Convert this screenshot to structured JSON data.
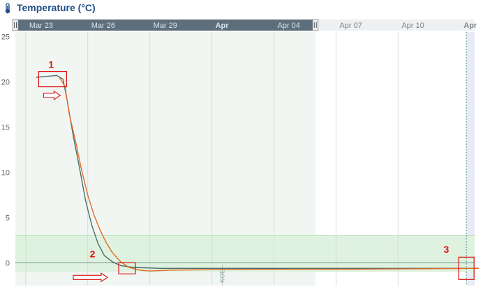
{
  "header": {
    "title": "Temperature (°C)",
    "icon": "thermometer-icon"
  },
  "chart_data": {
    "type": "line",
    "title": "Temperature (°C)",
    "ylim": [
      -2.5,
      25.5
    ],
    "y_ticks": [
      "25",
      "20",
      "15",
      "10",
      "5",
      "0"
    ],
    "y_tick_values": [
      25,
      20,
      15,
      10,
      5,
      0
    ],
    "x_ticks": [
      "Mar 23",
      "Mar 26",
      "Mar 29",
      "Apr",
      "Apr 04",
      "Apr 07",
      "Apr 10",
      "Apr"
    ],
    "x_tick_days": [
      0,
      3,
      6,
      9,
      12,
      15,
      18,
      21
    ],
    "x_range_days": [
      -0.5,
      21.7
    ],
    "selected_range_days": [
      -0.5,
      14
    ],
    "target_band": [
      -1,
      3
    ],
    "series": [
      {
        "color": "#4a6d6a",
        "points": [
          [
            0.5,
            20.5
          ],
          [
            1,
            20.6
          ],
          [
            1.5,
            20.7
          ],
          [
            1.8,
            20.3
          ],
          [
            2,
            18
          ],
          [
            2.3,
            14
          ],
          [
            2.6,
            10.5
          ],
          [
            2.9,
            6.8
          ],
          [
            3.2,
            4.1
          ],
          [
            3.5,
            2.1
          ],
          [
            3.8,
            0.8
          ],
          [
            4.2,
            0.1
          ],
          [
            4.6,
            -0.3
          ],
          [
            5.2,
            -0.5
          ],
          [
            6.5,
            -0.6
          ],
          [
            10,
            -0.6
          ],
          [
            14,
            -0.6
          ],
          [
            18,
            -0.6
          ],
          [
            21.9,
            -0.6
          ]
        ]
      },
      {
        "color": "#e36a26",
        "points": [
          [
            1.6,
            20.6
          ],
          [
            1.9,
            19.5
          ],
          [
            2.1,
            16.5
          ],
          [
            2.4,
            13.5
          ],
          [
            2.7,
            10.3
          ],
          [
            3,
            7.5
          ],
          [
            3.3,
            5.3
          ],
          [
            3.6,
            3.6
          ],
          [
            3.9,
            2.2
          ],
          [
            4.2,
            1.1
          ],
          [
            4.6,
            0.1
          ],
          [
            5,
            -0.5
          ],
          [
            5.5,
            -0.8
          ],
          [
            6,
            -0.9
          ],
          [
            7,
            -0.8
          ],
          [
            9,
            -0.75
          ],
          [
            13,
            -0.7
          ],
          [
            16,
            -0.7
          ],
          [
            19,
            -0.65
          ],
          [
            21.9,
            -0.6
          ]
        ]
      }
    ],
    "threshold_value": 0,
    "annotations": [
      "1",
      "2",
      "3"
    ],
    "vertical_marker_label": "KOE"
  },
  "colors": {
    "band": "#dff2df",
    "band_edge": "#b7ddb7",
    "selection": "#f1f6f3",
    "navigator": "#5d6f7c",
    "right_shade": "#e7ebf3",
    "annotation": "#dd1111"
  }
}
